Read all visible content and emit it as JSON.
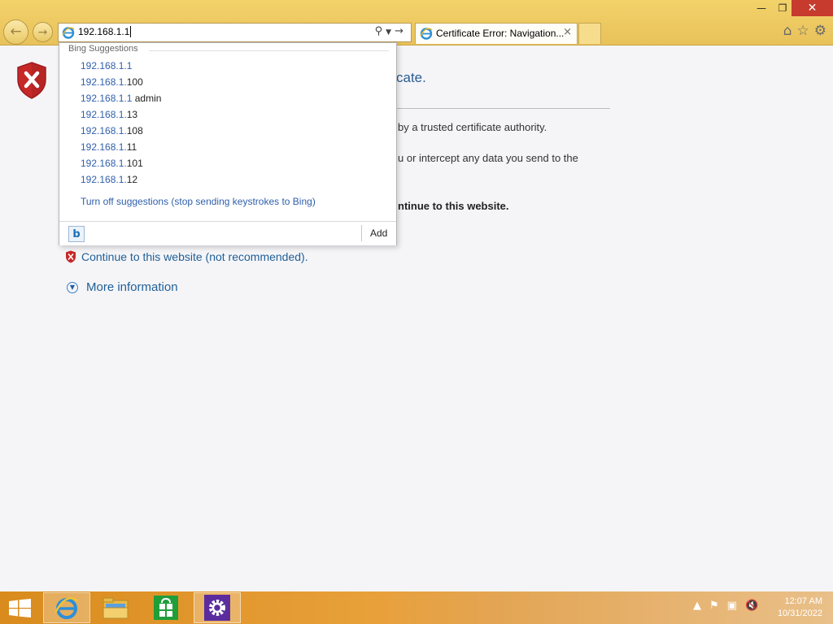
{
  "window": {
    "minimize": "—",
    "restore": "❐",
    "close": "✕"
  },
  "nav": {
    "back_icon": "back-arrow-icon",
    "forward_icon": "forward-arrow-icon"
  },
  "address_bar": {
    "value": "192.168.1.1",
    "icons": [
      "search-icon",
      "dropdown-icon",
      "go-arrow-icon"
    ]
  },
  "tab": {
    "title": "Certificate Error: Navigation...",
    "close": "×"
  },
  "toolbar_icons": [
    "home-icon",
    "favorites-star-icon",
    "tools-gear-icon"
  ],
  "suggestions": {
    "header": "Bing Suggestions",
    "items": [
      {
        "match": "192.168.1.1",
        "rest": ""
      },
      {
        "match": "192.168.1.",
        "rest": "100"
      },
      {
        "match": "192.168.1.1",
        "rest": " admin"
      },
      {
        "match": "192.168.1.",
        "rest": "13"
      },
      {
        "match": "192.168.1.",
        "rest": "108"
      },
      {
        "match": "192.168.1.",
        "rest": "11"
      },
      {
        "match": "192.168.1.",
        "rest": "101"
      },
      {
        "match": "192.168.1.",
        "rest": "12"
      }
    ],
    "turn_off": "Turn off suggestions (stop sending keystrokes to Bing)",
    "add_label": "Add"
  },
  "page": {
    "heading_fragment": "cate.",
    "line1_fragment": "by a trusted certificate authority.",
    "line2_fragment": "u or intercept any data you send to the",
    "line3_fragment": "ntinue to this website.",
    "continue_link": "Continue to this website (not recommended).",
    "more_info": "More information"
  },
  "colors": {
    "chrome": "#f0cd63",
    "link": "#1f5f96",
    "suggestion_match": "#2f5fab",
    "close_button": "#c73a2e"
  },
  "taskbar": {
    "time": "12:07 AM",
    "date": "10/31/2022"
  }
}
